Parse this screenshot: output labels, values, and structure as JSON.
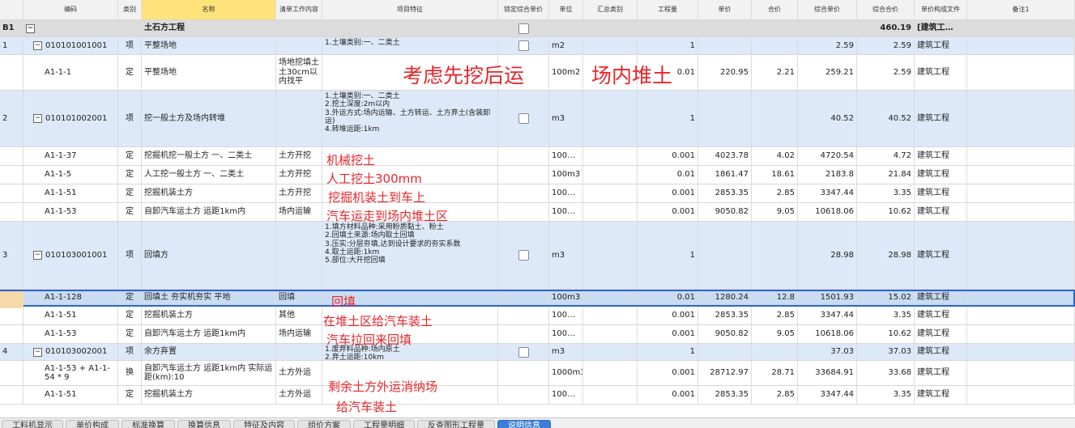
{
  "columns": [
    "编码",
    "类别",
    "名称",
    "清单工作内容",
    "项目特征",
    "锁定综合单价",
    "单位",
    "汇总类别",
    "工程量",
    "单价",
    "合价",
    "综合单价",
    "综合合价",
    "单价构成文件",
    "备注1"
  ],
  "group": {
    "id": "B1",
    "name": "土石方工程",
    "total": "460.19",
    "file": "[建筑工…"
  },
  "rows": [
    {
      "num": "1",
      "code": "010101001001",
      "type": "项",
      "name": "平整场地",
      "work": "",
      "feature": "1.土壤类别:一、二类土",
      "unit": "m2",
      "qty": "1",
      "price": "",
      "amount": "",
      "unit_price": "2.59",
      "total": "2.59",
      "file": "建筑工程"
    },
    {
      "num": "",
      "code": "A1-1-1",
      "type": "定",
      "name": "平整场地",
      "work": "场地挖填土土30cm以内找平",
      "feature": "",
      "unit": "100m2",
      "qty": "0.01",
      "price": "220.95",
      "amount": "2.21",
      "unit_price": "259.21",
      "total": "2.59",
      "file": "建筑工程"
    },
    {
      "num": "2",
      "code": "010101002001",
      "type": "项",
      "name": "挖一般土方及场内转堆",
      "work": "",
      "feature": "1.土壤类别:一、二类土\n2.挖土深度:2m以内\n3.外运方式:场内运输、土方转运、土方弃土(含装卸运)\n4.转堆运距:1km",
      "unit": "m3",
      "qty": "1",
      "price": "",
      "amount": "",
      "unit_price": "40.52",
      "total": "40.52",
      "file": "建筑工程"
    },
    {
      "num": "",
      "code": "A1-1-37",
      "type": "定",
      "name": "挖掘机挖一般土方 一、二类土",
      "work": "土方开挖",
      "feature": "",
      "unit": "100…",
      "qty": "0.001",
      "price": "4023.78",
      "amount": "4.02",
      "unit_price": "4720.54",
      "total": "4.72",
      "file": "建筑工程"
    },
    {
      "num": "",
      "code": "A1-1-5",
      "type": "定",
      "name": "人工挖一般土方 一、二类土",
      "work": "土方开挖",
      "feature": "",
      "unit": "100m3",
      "qty": "0.01",
      "price": "1861.47",
      "amount": "18.61",
      "unit_price": "2183.8",
      "total": "21.84",
      "file": "建筑工程"
    },
    {
      "num": "",
      "code": "A1-1-51",
      "type": "定",
      "name": "挖掘机装土方",
      "work": "土方开挖",
      "feature": "",
      "unit": "100…",
      "qty": "0.001",
      "price": "2853.35",
      "amount": "2.85",
      "unit_price": "3347.44",
      "total": "3.35",
      "file": "建筑工程"
    },
    {
      "num": "",
      "code": "A1-1-53",
      "type": "定",
      "name": "自卸汽车运土方 运距1km内",
      "work": "场内运输",
      "feature": "",
      "unit": "100…",
      "qty": "0.001",
      "price": "9050.82",
      "amount": "9.05",
      "unit_price": "10618.06",
      "total": "10.62",
      "file": "建筑工程"
    },
    {
      "num": "3",
      "code": "010103001001",
      "type": "项",
      "name": "回填方",
      "work": "",
      "feature": "1.填方材料品种:采用粉质黏土、粉土\n2.回填土来源:场内取土回填\n3.压实:分层夯填,达到设计要求的夯实系数\n4.取土运距:1km\n5.部位:大开挖回填",
      "unit": "m3",
      "qty": "1",
      "price": "",
      "amount": "",
      "unit_price": "28.98",
      "total": "28.98",
      "file": "建筑工程"
    },
    {
      "num": "",
      "code": "A1-1-128",
      "type": "定",
      "name": "回填土 夯实机夯实 平地",
      "work": "回填",
      "feature": "",
      "unit": "100m3",
      "qty": "0.01",
      "price": "1280.24",
      "amount": "12.8",
      "unit_price": "1501.93",
      "total": "15.02",
      "file": "建筑工程"
    },
    {
      "num": "",
      "code": "A1-1-51",
      "type": "定",
      "name": "挖掘机装土方",
      "work": "其他",
      "feature": "",
      "unit": "100…",
      "qty": "0.001",
      "price": "2853.35",
      "amount": "2.85",
      "unit_price": "3347.44",
      "total": "3.35",
      "file": "建筑工程"
    },
    {
      "num": "",
      "code": "A1-1-53",
      "type": "定",
      "name": "自卸汽车运土方 运距1km内",
      "work": "场内运输",
      "feature": "",
      "unit": "100…",
      "qty": "0.001",
      "price": "9050.82",
      "amount": "9.05",
      "unit_price": "10618.06",
      "total": "10.62",
      "file": "建筑工程"
    },
    {
      "num": "4",
      "code": "010103002001",
      "type": "项",
      "name": "余方弃置",
      "work": "",
      "feature": "1.废弃料品种:场内原土\n2.弃土运距:10km",
      "unit": "m3",
      "qty": "1",
      "price": "",
      "amount": "",
      "unit_price": "37.03",
      "total": "37.03",
      "file": "建筑工程"
    },
    {
      "num": "",
      "code": "A1-1-53 + A1-1-54 * 9",
      "type": "换",
      "name": "自卸汽车运土方 运距1km内 实际运距(km):10",
      "work": "土方外运",
      "feature": "",
      "unit": "1000m3",
      "qty": "0.001",
      "price": "28712.97",
      "amount": "28.71",
      "unit_price": "33684.91",
      "total": "33.68",
      "file": "建筑工程"
    },
    {
      "num": "",
      "code": "A1-1-51",
      "type": "定",
      "name": "挖掘机装土方",
      "work": "土方外运",
      "feature": "",
      "unit": "100…",
      "qty": "0.001",
      "price": "2853.35",
      "amount": "2.85",
      "unit_price": "3347.44",
      "total": "3.35",
      "file": "建筑工程"
    }
  ],
  "annotations": [
    "考虑先挖后运",
    "场内堆土",
    "机械挖土",
    "人工挖土300mm",
    "挖掘机装土到车上",
    "汽车运走到场内堆土区",
    "回填",
    "在堆土区给汽车装土",
    "汽车拉回来回填",
    "剩余土方外运消纳场",
    "给汽车装土"
  ],
  "tabs": [
    "工料机显示",
    "单价构成",
    "标准换算",
    "换算信息",
    "特征及内容",
    "组价方案",
    "工程量明细",
    "反查图形工程量",
    "说明信息"
  ],
  "active_tab": "说明信息",
  "colors": {
    "annotation": "#e8262a",
    "blue_row": "#dde9f8",
    "group_row": "#dcdcdc",
    "header_name": "#ffe27a",
    "active_tab": "#3b7dd8"
  }
}
